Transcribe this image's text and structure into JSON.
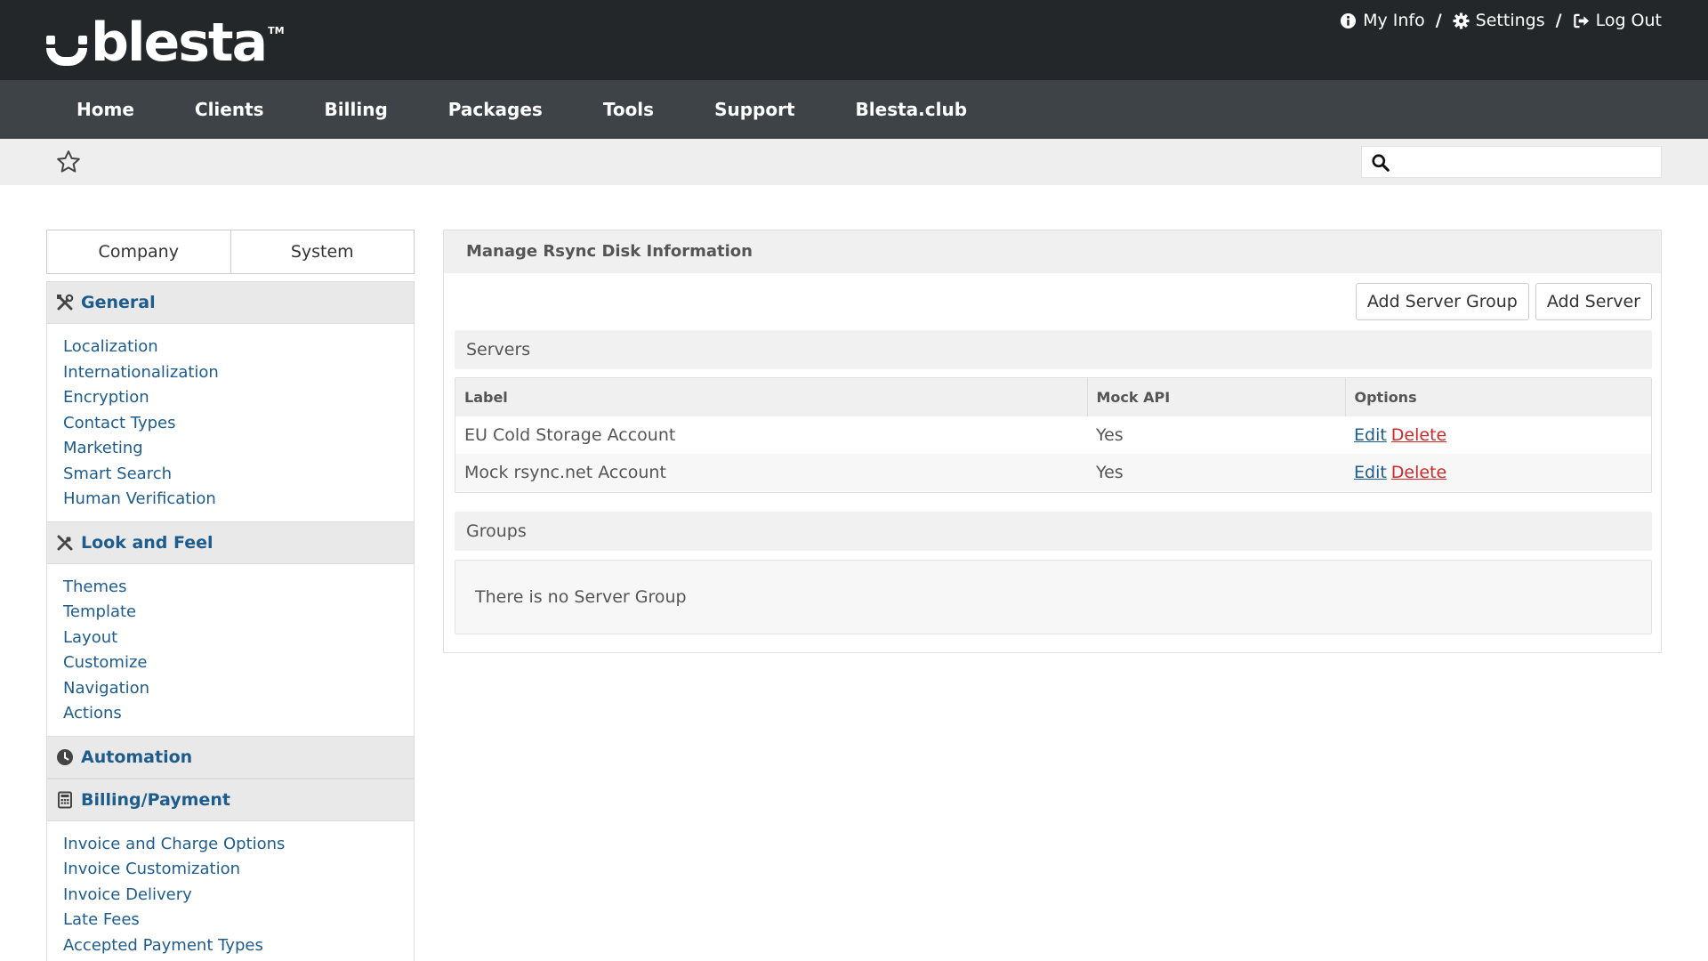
{
  "brand": {
    "name": "blesta",
    "tm": "TM"
  },
  "toplinks": [
    {
      "label": "My Info",
      "icon": "info-circle-icon"
    },
    {
      "label": "Settings",
      "icon": "gear-icon"
    },
    {
      "label": "Log Out",
      "icon": "sign-out-icon"
    }
  ],
  "separator": "/",
  "nav": [
    "Home",
    "Clients",
    "Billing",
    "Packages",
    "Tools",
    "Support",
    "Blesta.club"
  ],
  "search": {
    "placeholder": ""
  },
  "sidebar": {
    "tabs": [
      "Company",
      "System"
    ],
    "sections": [
      {
        "title": "General",
        "icon": "tools-icon",
        "items": [
          "Localization",
          "Internationalization",
          "Encryption",
          "Contact Types",
          "Marketing",
          "Smart Search",
          "Human Verification"
        ]
      },
      {
        "title": "Look and Feel",
        "icon": "paintbrush-icon",
        "items": [
          "Themes",
          "Template",
          "Layout",
          "Customize",
          "Navigation",
          "Actions"
        ]
      },
      {
        "title": "Automation",
        "icon": "clock-icon",
        "items": []
      },
      {
        "title": "Billing/Payment",
        "icon": "calculator-icon",
        "items": [
          "Invoice and Charge Options",
          "Invoice Customization",
          "Invoice Delivery",
          "Late Fees",
          "Accepted Payment Types"
        ]
      }
    ]
  },
  "main": {
    "title": "Manage Rsync Disk Information",
    "buttons": {
      "add_group": "Add Server Group",
      "add_server": "Add Server"
    },
    "servers": {
      "heading": "Servers",
      "columns": [
        "Label",
        "Mock API",
        "Options"
      ],
      "rows": [
        {
          "label": "EU Cold Storage Account",
          "mock_api": "Yes",
          "edit": "Edit",
          "delete": "Delete"
        },
        {
          "label": "Mock rsync.net Account",
          "mock_api": "Yes",
          "edit": "Edit",
          "delete": "Delete"
        }
      ]
    },
    "groups": {
      "heading": "Groups",
      "empty": "There is no Server Group"
    }
  },
  "colors": {
    "topbar": "#23272a",
    "navbar": "#3e4347",
    "link": "#1d5c8c",
    "delete": "#cc2b2b"
  }
}
